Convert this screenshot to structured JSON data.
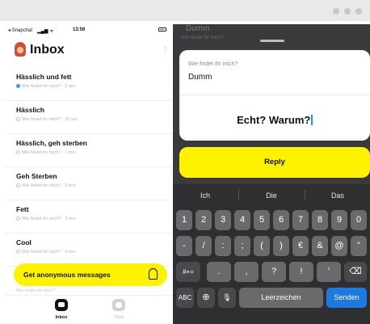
{
  "left": {
    "status": {
      "carrier": "◂ Snapchat",
      "time": "13:56"
    },
    "title": "Inbox",
    "rows": [
      {
        "title": "Hässlich und fett",
        "question": "Wie findet ihr mich?",
        "age": "2 sec"
      },
      {
        "title": "Hässlich",
        "question": "Wie findet ihr mich?",
        "age": "25 sec"
      },
      {
        "title": "Hässlich, geh sterben",
        "question": "Wie findet ihr mich?",
        "age": "1 min"
      },
      {
        "title": "Geh Sterben",
        "question": "Wie findet ihr mich?",
        "age": "2 min"
      },
      {
        "title": "Fett",
        "question": "Wie findet ihr mich?",
        "age": "3 min"
      },
      {
        "title": "Cool",
        "question": "Wie findet ihr mich?",
        "age": "4 sec"
      }
    ],
    "cta_label": "Get anonymous messages",
    "under_text": "Wie findet ihr mich?",
    "tabs": {
      "inbox": "Inbox",
      "chat": "Chat"
    }
  },
  "right": {
    "bg_title": "Dumm",
    "bg_sub": "Wie findet ihr mich?",
    "question": "Wie findet ihr mich?",
    "answer": "Dumm",
    "reply_text": "Echt? Warum?",
    "reply_button": "Reply",
    "suggestions": [
      "Ich",
      "Die",
      "Das"
    ],
    "keys_row1": [
      "1",
      "2",
      "3",
      "4",
      "5",
      "6",
      "7",
      "8",
      "9",
      "0"
    ],
    "keys_row2": [
      "-",
      "/",
      ":",
      ";",
      "(",
      ")",
      "€",
      "&",
      "@",
      "\""
    ],
    "keys_row3": [
      "#+=",
      ".",
      ",",
      "?",
      "!",
      "'",
      "⌫"
    ],
    "keys_row4": [
      "ABC",
      "⊕",
      "🎙",
      "Leerzeichen",
      "Senden"
    ]
  },
  "colors": {
    "accent": "#fff200",
    "send": "#1f7ae0",
    "unread": "#2d9cff"
  }
}
